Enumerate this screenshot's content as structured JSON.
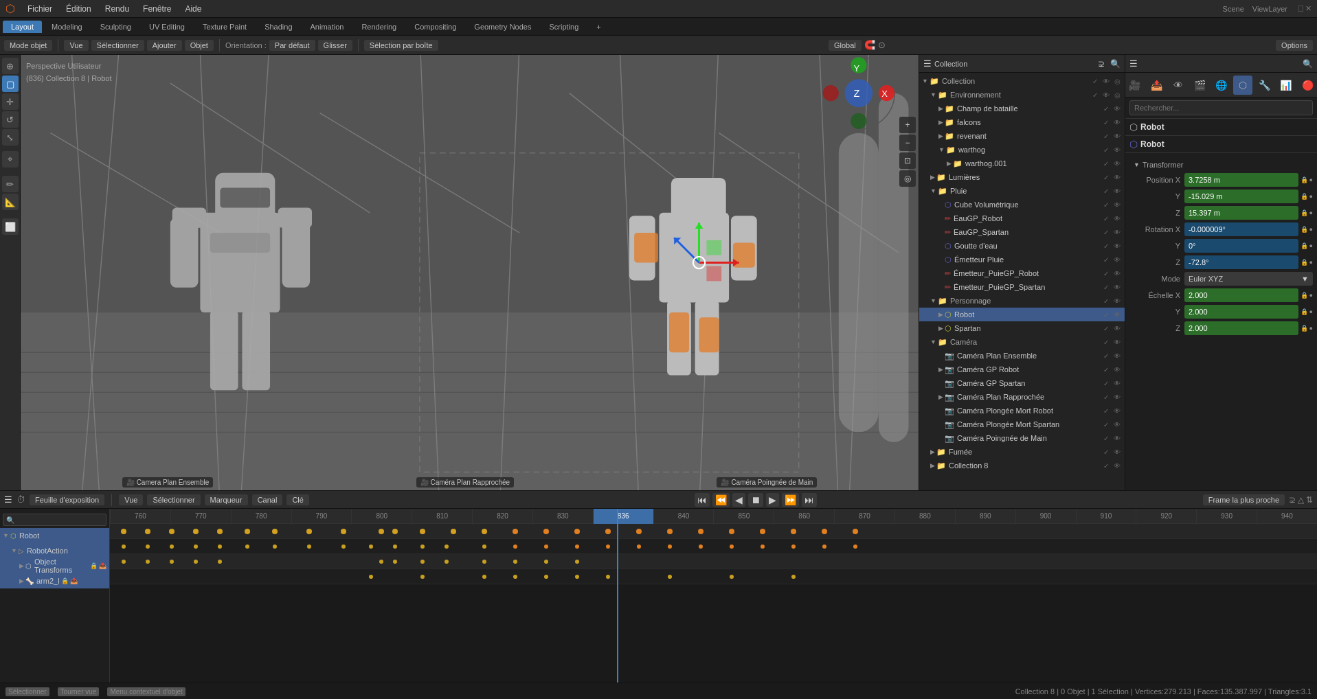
{
  "app": {
    "title": "Blender",
    "scene_name": "Scene",
    "view_layer": "ViewLayer"
  },
  "top_menu": {
    "items": [
      "Fichier",
      "Édition",
      "Rendu",
      "Fenêtre",
      "Aide"
    ]
  },
  "workspace_tabs": {
    "items": [
      "Layout",
      "Modeling",
      "Sculpting",
      "UV Editing",
      "Texture Paint",
      "Shading",
      "Animation",
      "Rendering",
      "Compositing",
      "Geometry Nodes",
      "Scripting"
    ],
    "active": "Layout",
    "plus": "+"
  },
  "editor_toolbar": {
    "mode_label": "Mode objet",
    "view_label": "Vue",
    "select_label": "Sélectionner",
    "add_label": "Ajouter",
    "object_label": "Objet",
    "orientation_label": "Orientation :",
    "orientation_mode": "Par défaut",
    "pivot_label": "Glisser",
    "snap_label": "Sélection par boîte",
    "transform_mode": "Global",
    "options_label": "Options"
  },
  "viewport": {
    "overlay_line1": "Perspective Utilisateur",
    "overlay_line2": "(836) Collection 8 | Robot",
    "camera_labels": [
      {
        "name": "Camera Plan Ensemble"
      },
      {
        "name": "Caméra Plan Rapprochée"
      },
      {
        "name": "Caméra Poingnée de Main"
      }
    ]
  },
  "outliner": {
    "header_label": "Collection",
    "items": [
      {
        "name": "Collection",
        "type": "collection",
        "indent": 0,
        "expanded": true
      },
      {
        "name": "Environnement",
        "type": "collection",
        "indent": 1,
        "expanded": true
      },
      {
        "name": "Champ de bataille",
        "type": "collection",
        "indent": 2,
        "expanded": false
      },
      {
        "name": "falcons",
        "type": "collection",
        "indent": 2,
        "expanded": false
      },
      {
        "name": "revenant",
        "type": "collection",
        "indent": 2,
        "expanded": false
      },
      {
        "name": "warthog",
        "type": "collection",
        "indent": 2,
        "expanded": false
      },
      {
        "name": "warthog.001",
        "type": "collection",
        "indent": 3,
        "expanded": false
      },
      {
        "name": "Lumières",
        "type": "collection",
        "indent": 1,
        "expanded": false
      },
      {
        "name": "Pluie",
        "type": "collection",
        "indent": 1,
        "expanded": true
      },
      {
        "name": "Cube Volumétrique",
        "type": "object",
        "indent": 2,
        "expanded": false
      },
      {
        "name": "EauGP_Robot",
        "type": "object",
        "indent": 2,
        "expanded": false
      },
      {
        "name": "EauGP_Spartan",
        "type": "object",
        "indent": 2,
        "expanded": false
      },
      {
        "name": "Goutte d'eau",
        "type": "object",
        "indent": 2,
        "expanded": false
      },
      {
        "name": "Émetteur Pluie",
        "type": "object",
        "indent": 2,
        "expanded": false
      },
      {
        "name": "Émetteur_PuieGP_Robot",
        "type": "object",
        "indent": 2,
        "expanded": false
      },
      {
        "name": "Émetteur_PuieGP_Spartan",
        "type": "object",
        "indent": 2,
        "expanded": false
      },
      {
        "name": "Personnage",
        "type": "collection",
        "indent": 1,
        "expanded": true
      },
      {
        "name": "Robot",
        "type": "object",
        "indent": 2,
        "expanded": false,
        "selected": true
      },
      {
        "name": "Spartan",
        "type": "object",
        "indent": 2,
        "expanded": false
      },
      {
        "name": "Caméra",
        "type": "collection",
        "indent": 1,
        "expanded": true
      },
      {
        "name": "Caméra Plan Ensemble",
        "type": "object",
        "indent": 2,
        "expanded": false
      },
      {
        "name": "Caméra GP Robot",
        "type": "object",
        "indent": 2,
        "expanded": false
      },
      {
        "name": "Caméra GP Spartan",
        "type": "object",
        "indent": 2,
        "expanded": false
      },
      {
        "name": "Caméra Plan Rapprochée",
        "type": "object",
        "indent": 2,
        "expanded": false
      },
      {
        "name": "Caméra Plongée Mort Robot",
        "type": "object",
        "indent": 2,
        "expanded": false
      },
      {
        "name": "Caméra Plongée Mort Spartan",
        "type": "object",
        "indent": 2,
        "expanded": false
      },
      {
        "name": "Caméra Poingnée de Main",
        "type": "object",
        "indent": 2,
        "expanded": false
      },
      {
        "name": "Fumée",
        "type": "collection",
        "indent": 1,
        "expanded": false
      },
      {
        "name": "Collection 8",
        "type": "collection",
        "indent": 1,
        "expanded": false
      }
    ]
  },
  "properties": {
    "header_search_placeholder": "Rechercher...",
    "object_name": "Robot",
    "object_type": "Robot",
    "section_transformer": "Transformer",
    "position": {
      "label": "Position X",
      "x": "3.7258 m",
      "y": "-15.029 m",
      "z": "15.397 m"
    },
    "rotation": {
      "label": "Rotation X",
      "x": "-0.000009°",
      "y": "0°",
      "z": "-72.8°",
      "mode_label": "Mode",
      "mode": "Euler XYZ"
    },
    "scale": {
      "label": "Échelle X",
      "x": "2.000",
      "y": "2.000",
      "z": "2.000"
    }
  },
  "timeline": {
    "header_label": "Feuille d'exposition",
    "menu_items": [
      "Vue",
      "Sélectionner",
      "Marqueur",
      "Canal",
      "Clé"
    ],
    "frame_current": "836",
    "playback_label": "Frame la plus proche",
    "ruler_frames": [
      "760",
      "770",
      "780",
      "790",
      "800",
      "810",
      "820",
      "830",
      "840",
      "850",
      "860",
      "870",
      "880",
      "890",
      "900",
      "910",
      "920",
      "930",
      "940"
    ],
    "tracks": [
      {
        "name": "Robot",
        "type": "root",
        "indent": 0,
        "expanded": true
      },
      {
        "name": "RobotAction",
        "type": "action",
        "indent": 1,
        "expanded": true
      },
      {
        "name": "Object Transforms",
        "type": "transforms",
        "indent": 2,
        "expanded": false
      },
      {
        "name": "arm2_l",
        "type": "bone",
        "indent": 2,
        "expanded": false
      }
    ]
  },
  "status_bar": {
    "select_label": "Sélectionner",
    "turn_label": "Tourner vue",
    "context_menu_label": "Menu contextuel d'objet",
    "info": "Collection 8 | 0 Objet | 1 Sélection | Vertices:279.213 | Faces:135.387.997 | Triangles:3.1"
  }
}
